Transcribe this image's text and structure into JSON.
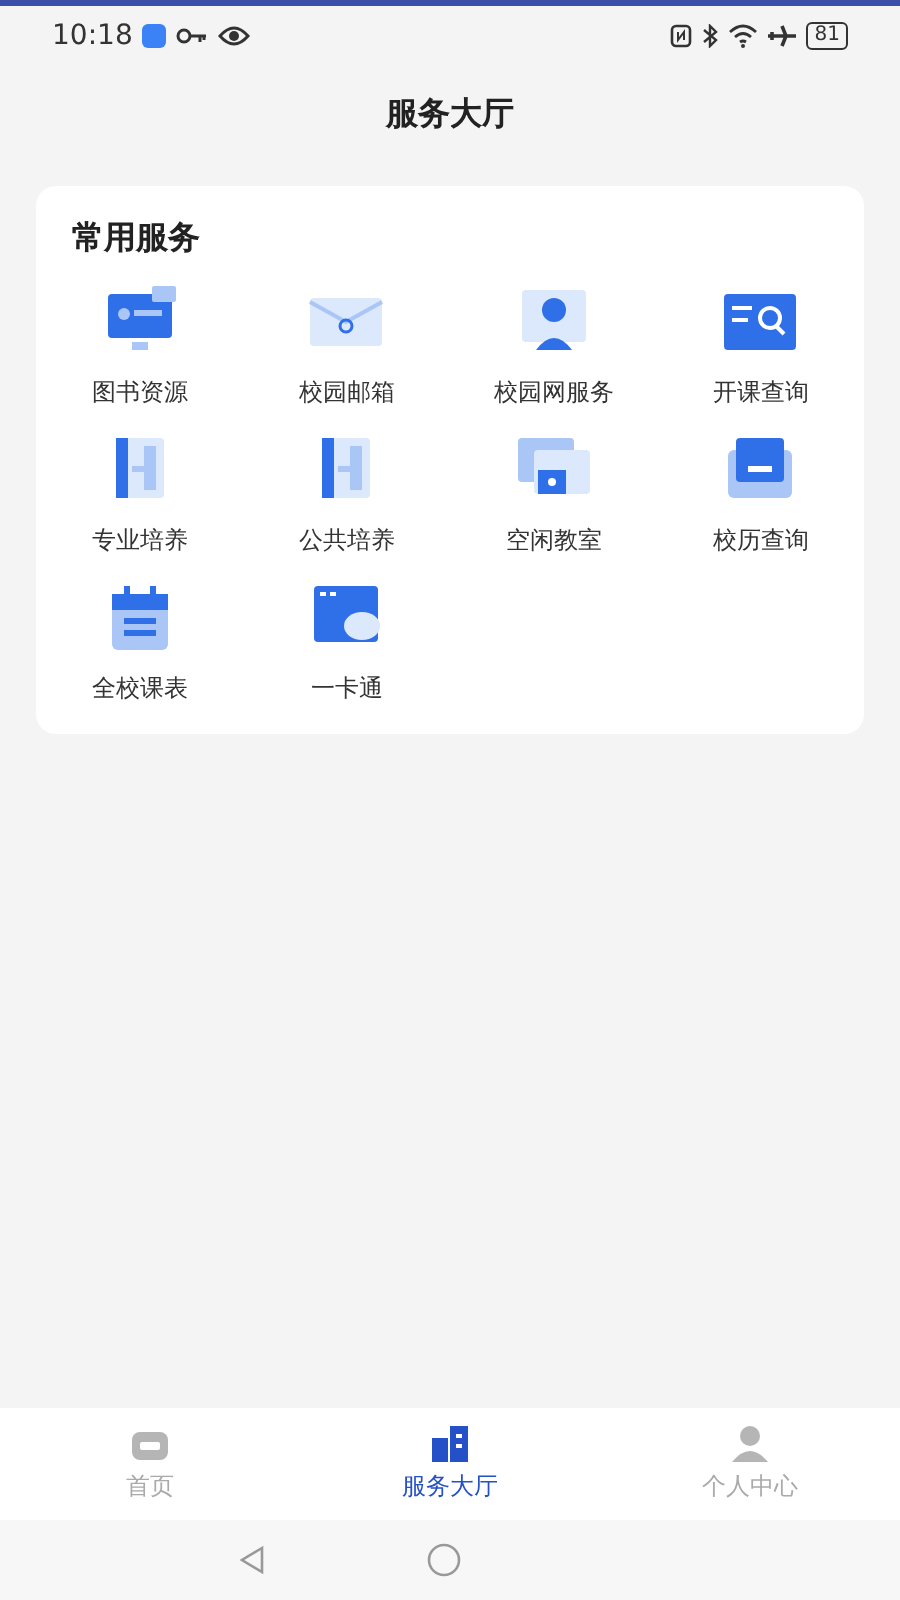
{
  "status_bar": {
    "time": "10:18",
    "battery": "81"
  },
  "header": {
    "title": "服务大厅"
  },
  "services": {
    "title": "常用服务",
    "items": [
      {
        "label": "图书资源"
      },
      {
        "label": "校园邮箱"
      },
      {
        "label": "校园网服务"
      },
      {
        "label": "开课查询"
      },
      {
        "label": "专业培养"
      },
      {
        "label": "公共培养"
      },
      {
        "label": "空闲教室"
      },
      {
        "label": "校历查询"
      },
      {
        "label": "全校课表"
      },
      {
        "label": "一卡通"
      }
    ]
  },
  "tab_bar": [
    {
      "label": "首页",
      "selected": false
    },
    {
      "label": "服务大厅",
      "selected": true
    },
    {
      "label": "个人中心",
      "selected": false
    }
  ]
}
